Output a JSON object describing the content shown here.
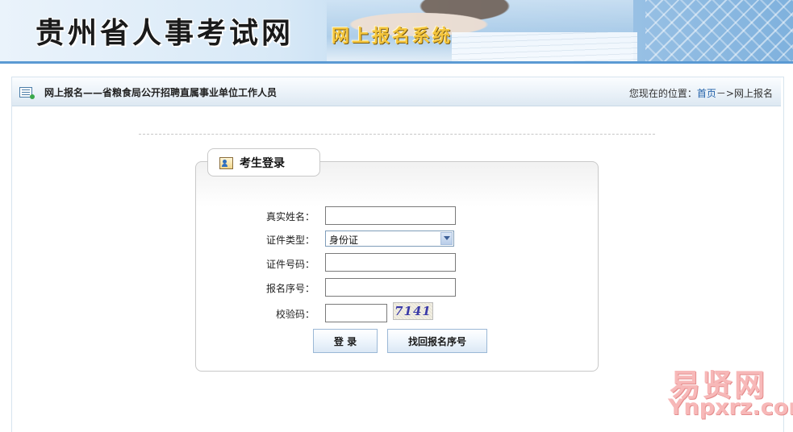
{
  "banner": {
    "title": "贵州省人事考试网",
    "subtitle": "网上报名系统"
  },
  "breadcrumb_bar": {
    "page_title": "网上报名——省粮食局公开招聘直属事业单位工作人员",
    "location_prefix": "您现在的位置：",
    "home_link": "首页",
    "separator": "－>",
    "current": "网上报名"
  },
  "login": {
    "tab_label": "考生登录",
    "fields": {
      "name_label": "真实姓名：",
      "name_value": "",
      "id_type_label": "证件类型：",
      "id_type_selected": "身份证",
      "id_number_label": "证件号码：",
      "id_number_value": "",
      "reg_number_label": "报名序号：",
      "reg_number_value": "",
      "captcha_label": "校验码：",
      "captcha_value": "",
      "captcha_image_text": "7141"
    },
    "buttons": {
      "login": "登 录",
      "recover": "找回报名序号"
    }
  },
  "watermark": {
    "line1": "易贤网",
    "line2": "Ynpxrz.com"
  },
  "colors": {
    "banner_border": "#5b9ad3",
    "link": "#1f5fa8",
    "subtitle_gold": "#f5c63d",
    "watermark_pink": "#f7b8b8"
  }
}
